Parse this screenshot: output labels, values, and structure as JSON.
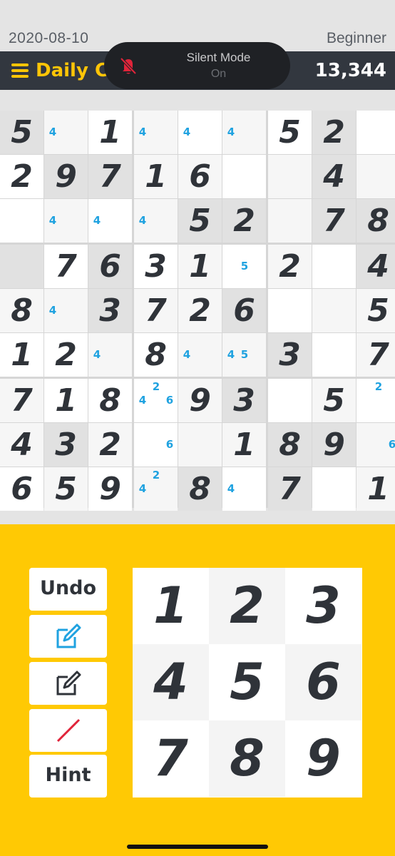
{
  "header": {
    "date": "2020-08-10",
    "difficulty": "Beginner",
    "title": "Daily C",
    "score": "13,344",
    "menu_icon": "hamburger-menu-icon"
  },
  "toast": {
    "title": "Silent Mode",
    "status": "On",
    "icon": "bell-slash-icon",
    "icon_color": "#e0243a"
  },
  "board": {
    "givens": [
      [
        "5",
        "",
        "1",
        "",
        "",
        "",
        "5",
        "2",
        ""
      ],
      [
        "2",
        "9",
        "7",
        "1",
        "6",
        "",
        "",
        "4",
        ""
      ],
      [
        "",
        "",
        "",
        "",
        "5",
        "2",
        "",
        "7",
        "8"
      ],
      [
        "",
        "7",
        "6",
        "3",
        "1",
        "",
        "2",
        "",
        "4"
      ],
      [
        "8",
        "",
        "3",
        "7",
        "2",
        "6",
        "",
        "",
        "5"
      ],
      [
        "1",
        "2",
        "",
        "8",
        "",
        "",
        "3",
        "",
        "7"
      ],
      [
        "7",
        "1",
        "8",
        "",
        "9",
        "3",
        "",
        "5",
        ""
      ],
      [
        "4",
        "3",
        "2",
        "",
        "",
        "1",
        "8",
        "9",
        ""
      ],
      [
        "6",
        "5",
        "9",
        "",
        "8",
        "",
        "7",
        "",
        "1"
      ]
    ],
    "notes": [
      [
        "",
        "4",
        "",
        "4",
        "4",
        "4",
        "",
        "",
        ""
      ],
      [
        "",
        "",
        "",
        "",
        "",
        "",
        "",
        "",
        ""
      ],
      [
        "",
        "4",
        "4",
        "4",
        "",
        "",
        "",
        "",
        ""
      ],
      [
        "",
        "",
        "",
        "",
        "",
        "5",
        "",
        "",
        ""
      ],
      [
        "",
        "4",
        "",
        "",
        "",
        "",
        "",
        "",
        ""
      ],
      [
        "",
        "",
        "4",
        "",
        "4",
        "45",
        "",
        "",
        ""
      ],
      [
        "",
        "",
        "",
        "246",
        "",
        "",
        "",
        "",
        "2"
      ],
      [
        "",
        "",
        "",
        "6",
        "",
        "",
        "",
        "",
        "6"
      ],
      [
        "",
        "",
        "",
        "24",
        "",
        "4",
        "",
        "",
        ""
      ]
    ],
    "colors": {
      "given": "#2f3339",
      "note": "#1fa2e0"
    }
  },
  "controls": {
    "undo_label": "Undo",
    "hint_label": "Hint",
    "notes_icon": "pencil-notes-icon",
    "edit_icon": "pencil-edit-icon",
    "erase_icon": "eraser-slash-icon",
    "accent": "#ffc904"
  },
  "numpad": {
    "keys": [
      "1",
      "2",
      "3",
      "4",
      "5",
      "6",
      "7",
      "8",
      "9"
    ]
  }
}
